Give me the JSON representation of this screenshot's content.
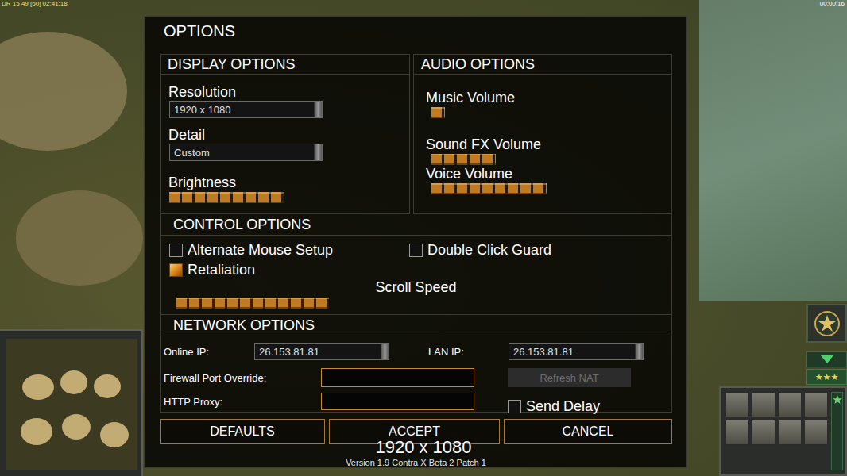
{
  "hud": {
    "debug": "DR 15 49 [60] 02:41:18",
    "timer": "00:00:16",
    "rank_stars": "★★★"
  },
  "window": {
    "title": "OPTIONS"
  },
  "display": {
    "title": "DISPLAY OPTIONS",
    "resolution": {
      "label": "Resolution",
      "value": "1920 x 1080"
    },
    "detail": {
      "label": "Detail",
      "value": "Custom"
    },
    "brightness": {
      "label": "Brightness",
      "level": 0.5
    }
  },
  "audio": {
    "title": "AUDIO OPTIONS",
    "sliders": [
      {
        "label": "Music Volume",
        "level": 0.06
      },
      {
        "label": "Sound FX Volume",
        "level": 0.28
      },
      {
        "label": "Voice Volume",
        "level": 0.5
      }
    ]
  },
  "controls": {
    "title": "CONTROL OPTIONS",
    "checkboxes": [
      {
        "label": "Alternate Mouse Setup",
        "checked": false
      },
      {
        "label": "Double Click Guard",
        "checked": false
      },
      {
        "label": "Retaliation",
        "checked": true
      }
    ],
    "scroll_speed": {
      "label": "Scroll Speed",
      "level": 0.32
    }
  },
  "network": {
    "title": "NETWORK OPTIONS",
    "online_ip": {
      "label": "Online IP:",
      "value": "26.153.81.81"
    },
    "lan_ip": {
      "label": "LAN IP:",
      "value": "26.153.81.81"
    },
    "firewall_port": {
      "label": "Firewall Port Override:",
      "value": ""
    },
    "http_proxy": {
      "label": "HTTP Proxy:",
      "value": ""
    },
    "refresh_nat": {
      "label": "Refresh NAT",
      "disabled": true
    },
    "send_delay": {
      "label": "Send Delay",
      "checked": false
    }
  },
  "buttons": [
    {
      "label": "DEFAULTS"
    },
    {
      "label": "ACCEPT"
    },
    {
      "label": "CANCEL"
    }
  ],
  "version": "Version 1.9 Contra X Beta 2 Patch 1",
  "overlay": "1920 x 1080"
}
